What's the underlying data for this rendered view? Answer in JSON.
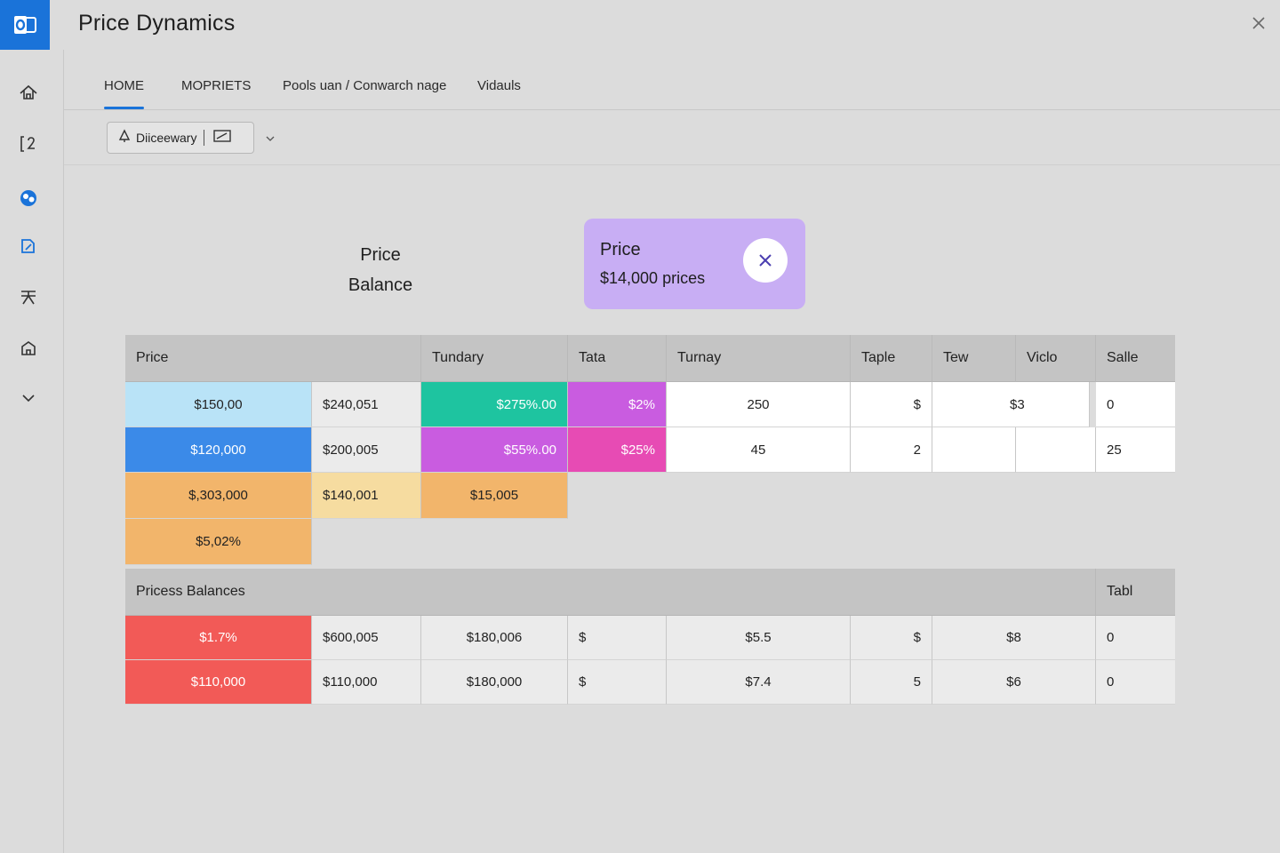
{
  "window": {
    "title": "Price Dynamics"
  },
  "tabs": [
    {
      "label": "HOME",
      "active": true
    },
    {
      "label": "MOPRIETS",
      "active": false
    },
    {
      "label": "Pools uan / Conwarch nage",
      "active": false
    },
    {
      "label": "Vidauls",
      "active": false
    }
  ],
  "toolbar": {
    "group_label": "Diiceewary"
  },
  "headline": {
    "line1": "Price",
    "line2": "Balance"
  },
  "info_card": {
    "title": "Price",
    "subtitle": "$14,000 prices"
  },
  "table": {
    "headers": [
      "Price",
      "Tundary",
      "Tata",
      "Turnay",
      "Taple",
      "Tew",
      "Viclo",
      "Salle"
    ],
    "top_rows": [
      [
        "$150,00",
        "$240,051",
        "$275%.00",
        "$2%",
        "250",
        "$",
        "$3",
        "0"
      ],
      [
        "$120,000",
        "$200,005",
        "$55%.00",
        "$25%",
        "45",
        "2",
        "",
        "25"
      ],
      [
        "$,303,000",
        "$140,001",
        "$15,005"
      ],
      [
        "$5,02%"
      ]
    ],
    "section_header": {
      "label": "Pricess Balances",
      "right_label": "Tabl"
    },
    "bottom_rows": [
      [
        "$1.7%",
        "$600,005",
        "$180,006",
        "$",
        "$5.5",
        "$",
        "$8",
        "0"
      ],
      [
        "$110,000",
        "$110,000",
        "$180,000",
        "$",
        "$7.4",
        "5",
        "$6",
        "0"
      ]
    ]
  },
  "colors": {
    "accent": "#1a73d9",
    "card": "#c8aef4",
    "light_blue": "#b9e3f7",
    "blue": "#3b8ae8",
    "teal": "#1ec4a0",
    "purple": "#c95ce0",
    "magenta": "#e74bb4",
    "orange": "#f2b56b",
    "pale_orange": "#f6dca0",
    "red": "#f25a57"
  }
}
